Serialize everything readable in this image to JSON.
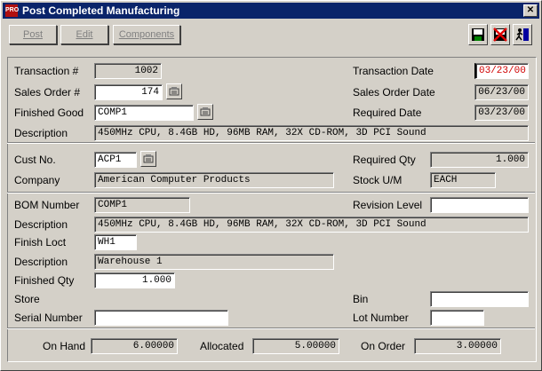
{
  "window": {
    "title": "Post Completed Manufacturing",
    "icon_text": "PRO",
    "close": "✕"
  },
  "toolbar": {
    "post": "Post",
    "edit": "Edit",
    "components": "Components"
  },
  "transaction": {
    "label": "Transaction #",
    "value": "1002"
  },
  "transaction_date": {
    "label": "Transaction Date",
    "value": "03/23/00"
  },
  "sales_order": {
    "label": "Sales Order #",
    "value": "174"
  },
  "sales_order_date": {
    "label": "Sales Order Date",
    "value": "06/23/00"
  },
  "finished_good": {
    "label": "Finished Good",
    "value": "COMP1"
  },
  "required_date": {
    "label": "Required Date",
    "value": "03/23/00"
  },
  "description1": {
    "label": "Description",
    "value": "450MHz CPU, 8.4GB HD, 96MB RAM, 32X CD-ROM, 3D PCI Sound"
  },
  "cust_no": {
    "label": "Cust No.",
    "value": "ACP1"
  },
  "required_qty": {
    "label": "Required Qty",
    "value": "1.000"
  },
  "company": {
    "label": "Company",
    "value": "American Computer Products"
  },
  "stock_um": {
    "label": "Stock U/M",
    "value": "EACH"
  },
  "bom_number": {
    "label": "BOM Number",
    "value": "COMP1"
  },
  "revision_level": {
    "label": "Revision Level",
    "value": ""
  },
  "description2": {
    "label": "Description",
    "value": "450MHz CPU, 8.4GB HD, 96MB RAM, 32X CD-ROM, 3D PCI Sound"
  },
  "finish_loct": {
    "label": "Finish Loct",
    "value": "WH1"
  },
  "description3": {
    "label": "Description",
    "value": "Warehouse 1"
  },
  "finished_qty": {
    "label": "Finished Qty",
    "value": "1.000"
  },
  "store": {
    "label": "Store"
  },
  "bin": {
    "label": "Bin",
    "value": ""
  },
  "serial_number": {
    "label": "Serial Number",
    "value": ""
  },
  "lot_number": {
    "label": "Lot Number",
    "value": ""
  },
  "on_hand": {
    "label": "On Hand",
    "value": "6.00000"
  },
  "allocated": {
    "label": "Allocated",
    "value": "5.00000"
  },
  "on_order": {
    "label": "On Order",
    "value": "3.00000"
  },
  "icons": [
    "app-icon",
    "save-icon",
    "cancel-icon",
    "exit-icon",
    "lookup-icon"
  ],
  "colors": {
    "title_bar": "#0a246a",
    "date_red": "#d00000",
    "face": "#d4d0c8"
  }
}
